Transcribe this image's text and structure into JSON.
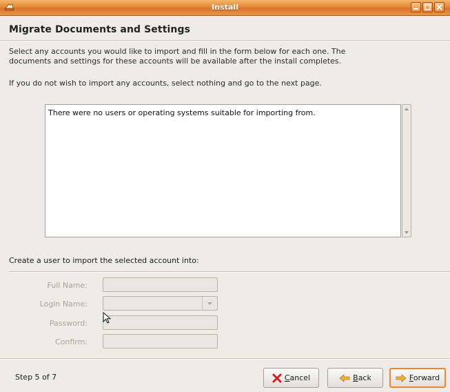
{
  "window": {
    "title": "Install"
  },
  "page": {
    "heading": "Migrate Documents and Settings",
    "description_line1": "Select any accounts you would like to import and fill in the form below for each one.  The",
    "description_line2": "documents and settings for these accounts will be available after the install completes.",
    "hint": "If you do not wish to import any accounts, select nothing and go to the next page."
  },
  "accounts_list": {
    "message": "There were no users or operating systems suitable for importing from."
  },
  "form": {
    "label": "Create a user to import the selected account into:",
    "full_name_label": "Full Name:",
    "login_name_label": "Login Name:",
    "password_label": "Password:",
    "confirm_label": "Confirm:"
  },
  "footer": {
    "step": "Step 5 of 7",
    "cancel_mnemonic": "C",
    "cancel_rest": "ancel",
    "back_mnemonic": "B",
    "back_rest": "ack",
    "forward_mnemonic": "F",
    "forward_rest": "orward"
  },
  "colors": {
    "titlebar": "#e68a34",
    "window_bg": "#efebe7",
    "default_button_border": "#e5883a"
  }
}
